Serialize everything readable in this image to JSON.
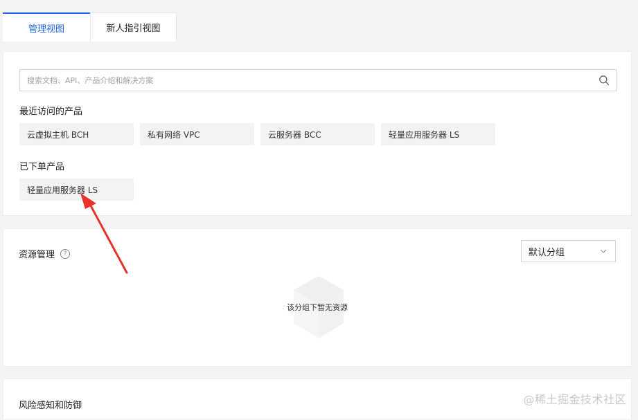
{
  "tabs": [
    {
      "label": "管理视图",
      "active": true
    },
    {
      "label": "新人指引视图",
      "active": false
    }
  ],
  "search": {
    "placeholder": "搜索文档、API、产品介绍和解决方案",
    "icon": "search-icon"
  },
  "recent": {
    "label": "最近访问的产品",
    "items": [
      "云虚拟主机 BCH",
      "私有网络 VPC",
      "云服务器 BCC",
      "轻量应用服务器 LS"
    ]
  },
  "ordered": {
    "label": "已下单产品",
    "items": [
      "轻量应用服务器 LS"
    ]
  },
  "resources": {
    "title": "资源管理",
    "help": "?",
    "group_select": "默认分组",
    "empty_text": "该分组下暂无资源"
  },
  "risk": {
    "title": "风险感知和防御"
  },
  "watermark": "@稀土掘金技术社区",
  "colors": {
    "accent": "#2468f2",
    "annotation_arrow": "#e8322a"
  }
}
